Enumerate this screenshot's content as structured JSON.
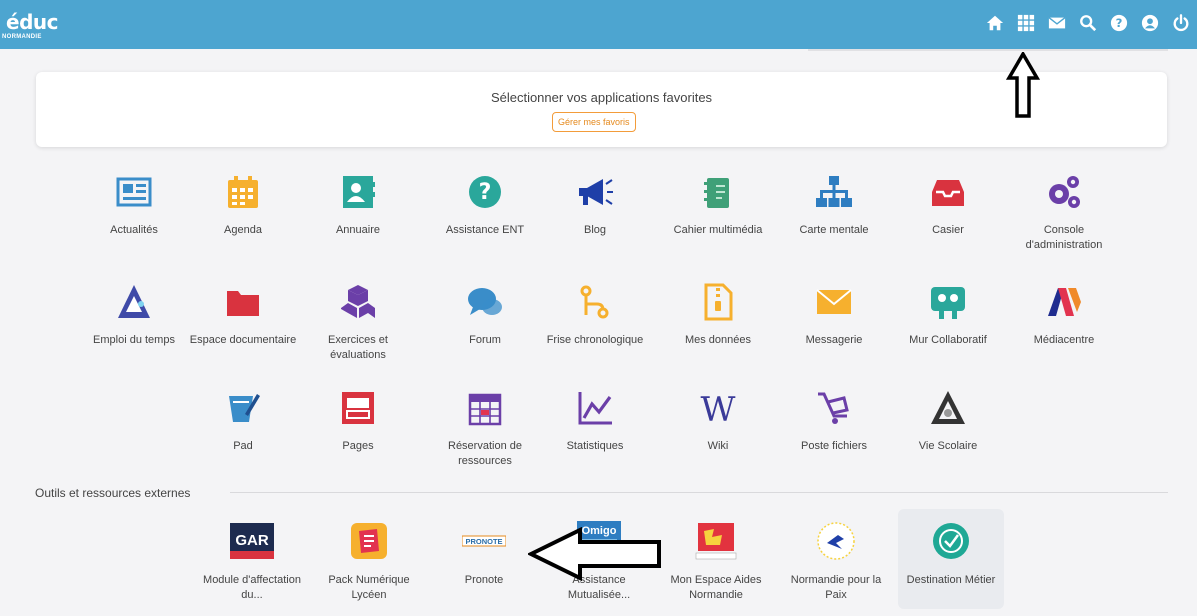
{
  "header": {
    "logo_main": "éduc",
    "logo_sub": "NORMANDIE",
    "icons": [
      "home-icon",
      "apps-grid-icon",
      "mail-icon",
      "search-icon",
      "help-icon",
      "user-icon",
      "power-icon"
    ]
  },
  "favorites": {
    "title": "Sélectionner vos applications favorites",
    "button": "Gérer mes favoris"
  },
  "apps": [
    {
      "label": "Actualités",
      "icon": "newspaper-icon",
      "color": "#3a8dc9"
    },
    {
      "label": "Agenda",
      "icon": "calendar-icon",
      "color": "#f6b02e"
    },
    {
      "label": "Annuaire",
      "icon": "contacts-icon",
      "color": "#2aa79b"
    },
    {
      "label": "Assistance ENT",
      "icon": "question-icon",
      "color": "#2aa79b"
    },
    {
      "label": "Blog",
      "icon": "megaphone-icon",
      "color": "#1f3fa8"
    },
    {
      "label": "Cahier multimédia",
      "icon": "notebook-icon",
      "color": "#3fa078"
    },
    {
      "label": "Carte mentale",
      "icon": "sitemap-icon",
      "color": "#2e7dc1"
    },
    {
      "label": "Casier",
      "icon": "inbox-icon",
      "color": "#d9333f"
    },
    {
      "label": "Console d'administration",
      "icon": "cogs-icon",
      "color": "#6b3fa8"
    },
    {
      "label": "Emploi du temps",
      "icon": "timetable-icon",
      "color": "#3f4aa8"
    },
    {
      "label": "Espace documentaire",
      "icon": "folder-icon",
      "color": "#d9333f"
    },
    {
      "label": "Exercices et évaluations",
      "icon": "cubes-icon",
      "color": "#6b3fa8"
    },
    {
      "label": "Forum",
      "icon": "comments-icon",
      "color": "#3a8dc9"
    },
    {
      "label": "Frise chronologique",
      "icon": "timeline-icon",
      "color": "#f6b02e"
    },
    {
      "label": "Mes données",
      "icon": "file-zip-icon",
      "color": "#f6b02e"
    },
    {
      "label": "Messagerie",
      "icon": "envelope-icon",
      "color": "#f6b02e"
    },
    {
      "label": "Mur Collaboratif",
      "icon": "board-icon",
      "color": "#2aa79b"
    },
    {
      "label": "Médiacentre",
      "icon": "mediacentre-icon",
      "color": "#e2334f"
    },
    {
      "label": "Pad",
      "icon": "pad-icon",
      "color": "#3a8dc9"
    },
    {
      "label": "Pages",
      "icon": "pages-icon",
      "color": "#d9333f"
    },
    {
      "label": "Réservation de ressources",
      "icon": "booking-calendar-icon",
      "color": "#6b3fa8"
    },
    {
      "label": "Statistiques",
      "icon": "line-chart-icon",
      "color": "#6b3fa8"
    },
    {
      "label": "Wiki",
      "icon": "wikipedia-icon",
      "color": "#3a3a99"
    },
    {
      "label": "Poste fichiers",
      "icon": "cart-icon",
      "color": "#6b3fa8"
    },
    {
      "label": "Vie Scolaire",
      "icon": "vie-scolaire-icon",
      "color": "#333333"
    }
  ],
  "external": {
    "section_title": "Outils et ressources externes",
    "items": [
      {
        "label": "Module d'affectation du...",
        "icon": "gar-logo",
        "logo_text": "GAR"
      },
      {
        "label": "Pack Numérique Lycéen",
        "icon": "pack-numerique-logo"
      },
      {
        "label": "Pronote",
        "icon": "pronote-logo",
        "logo_text": "PRONOTE"
      },
      {
        "label": "Assistance Mutualisée...",
        "icon": "assistance-mutualisee-logo",
        "logo_text": "Omigo"
      },
      {
        "label": "Mon Espace Aides Normandie",
        "icon": "normandie-region-logo"
      },
      {
        "label": "Normandie pour la Paix",
        "icon": "normandie-paix-logo"
      },
      {
        "label": "Destination Métier",
        "icon": "destination-metier-logo"
      }
    ]
  }
}
